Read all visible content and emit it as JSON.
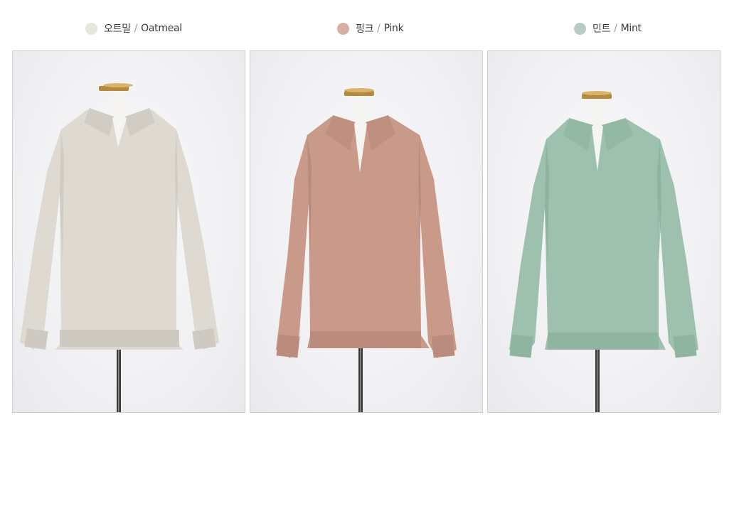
{
  "colors": [
    {
      "korean": "오트밀",
      "sep": "/",
      "english": "Oatmeal",
      "swatch": "#e8e5e0",
      "garment": "#dedad2",
      "shade": "#cbc6bc"
    },
    {
      "korean": "핑크",
      "sep": "/",
      "english": "Pink",
      "swatch": "#d9aea2",
      "garment": "#c99a8a",
      "shade": "#b4867a"
    },
    {
      "korean": "민트",
      "sep": "/",
      "english": "Mint",
      "swatch": "#b8ccc1",
      "garment": "#9dc1ae",
      "shade": "#88ad9a"
    }
  ]
}
